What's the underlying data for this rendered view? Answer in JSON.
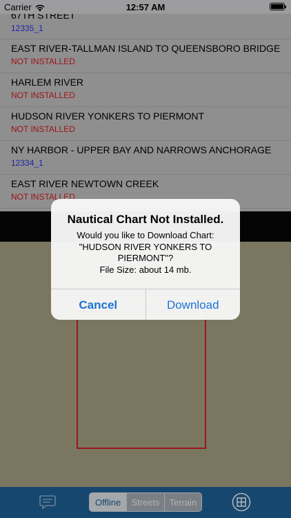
{
  "status_bar": {
    "carrier": "Carrier",
    "time": "12:57 AM"
  },
  "chart_list": [
    {
      "title": "67TH STREET",
      "subtitle": "12335_1",
      "status": "installed"
    },
    {
      "title": "EAST RIVER-TALLMAN ISLAND TO QUEENSBORO BRIDGE",
      "subtitle": "NOT INSTALLED",
      "status": "not-installed"
    },
    {
      "title": "HARLEM RIVER",
      "subtitle": "NOT INSTALLED",
      "status": "not-installed"
    },
    {
      "title": "HUDSON RIVER YONKERS TO PIERMONT",
      "subtitle": "NOT INSTALLED",
      "status": "not-installed"
    },
    {
      "title": "NY HARBOR - UPPER BAY AND NARROWS ANCHORAGE",
      "subtitle": "12334_1",
      "status": "installed"
    },
    {
      "title": "EAST RIVER NEWTOWN CREEK",
      "subtitle": "NOT INSTALLED",
      "status": "not-installed"
    }
  ],
  "colors": {
    "installed": "#2b2fd8",
    "not_installed": "#d01a1a",
    "chart_outline": "#c8202a",
    "toolbar": "#1d5e93",
    "alert_button": "#1a73d6"
  },
  "toolbar": {
    "left_icon": "chat-bubble-icon",
    "segments": [
      "Offline",
      "Streets",
      "Terrain"
    ],
    "selected_segment": "Offline",
    "right_icon": "add-square-icon"
  },
  "alert": {
    "title": "Nautical Chart Not Installed.",
    "message_lines": [
      "Would you like to Download Chart:",
      "\"HUDSON RIVER YONKERS TO",
      "PIERMONT\"?",
      "File Size: about 14 mb."
    ],
    "cancel_label": "Cancel",
    "download_label": "Download"
  }
}
